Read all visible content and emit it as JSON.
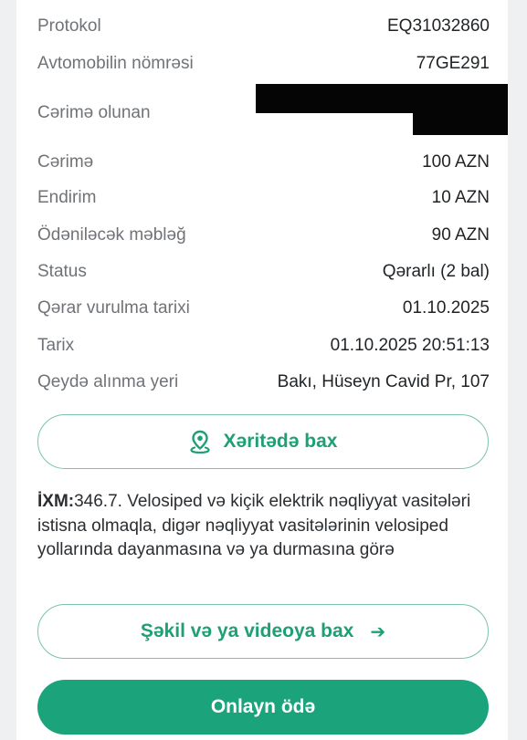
{
  "details": {
    "protokol": {
      "label": "Protokol",
      "value": "EQ31032860"
    },
    "avtomobil": {
      "label": "Avtomobilin nömrəsi",
      "value": "77GE291"
    },
    "cerime_olunan": {
      "label": "Cərimə olunan"
    },
    "cerime": {
      "label": "Cərimə",
      "value": "100 AZN"
    },
    "endirim": {
      "label": "Endirim",
      "value": "10 AZN"
    },
    "odenilecek": {
      "label": "Ödəniləcək məbləğ",
      "value": "90 AZN"
    },
    "status": {
      "label": "Status",
      "value": "Qərarlı (2 bal)"
    },
    "qerar_tarixi": {
      "label": "Qərar vurulma tarixi",
      "value": "01.10.2025"
    },
    "tarix": {
      "label": "Tarix",
      "value": "01.10.2025 20:51:13"
    },
    "qeyde_yeri": {
      "label": "Qeydə alınma yeri",
      "value": "Bakı, Hüseyn Cavid Pr, 107"
    }
  },
  "map_button": {
    "label": "Xəritədə bax",
    "icon": "map-pin-icon"
  },
  "violation": {
    "code": "İXM:",
    "text": "346.7. Velosiped və kiçik elektrik nəqliyyat vasitələri istisna olmaqla, digər nəqliyyat vasitələrinin velosiped yollarında dayanmasına və ya durmasına görə"
  },
  "media_button": {
    "label": "Şəkil və ya videoya bax",
    "icon": "arrow-right-icon"
  },
  "pay_button": {
    "label": "Onlayn ödə"
  },
  "colors": {
    "accent": "#1ba37c",
    "accent_text": "#1f9f74",
    "outline": "#79c5a8"
  }
}
